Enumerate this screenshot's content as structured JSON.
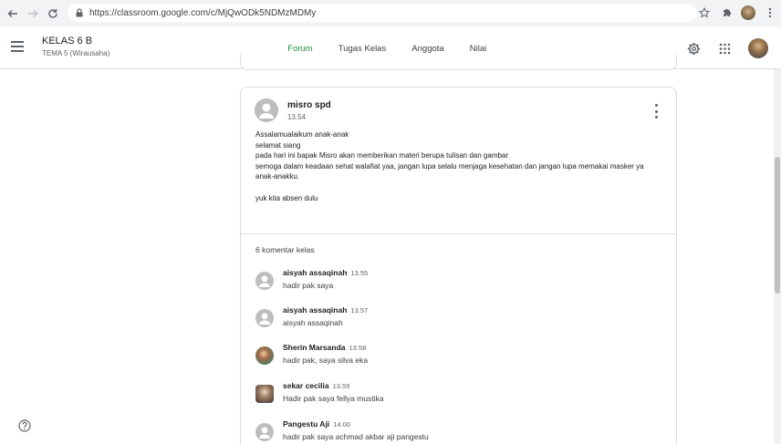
{
  "browser": {
    "url": "https://classroom.google.com/c/MjQwODk5NDMzMDMy"
  },
  "header": {
    "class_title": "KELAS 6 B",
    "class_subtitle": "TEMA 5 (Wirausaha)",
    "tabs": [
      {
        "label": "Forum",
        "active": true
      },
      {
        "label": "Tugas Kelas",
        "active": false
      },
      {
        "label": "Anggota",
        "active": false
      },
      {
        "label": "Nilai",
        "active": false
      }
    ]
  },
  "post": {
    "author": "misro spd",
    "time": "13.54",
    "body": [
      "Assalamualaikum anak-anak",
      "selamat siang",
      "pada hari ini bapak Misro akan memberikan materi berupa tulisan dan gambar",
      "semoga dalam keadaan sehat walafiat yaa, jangan lupa selalu menjaga kesehatan dan jangan lupa memakai masker ya",
      "anak-anakku.",
      "",
      "yuk kita absen dulu"
    ],
    "comments_count": "6 komentar kelas",
    "comments": [
      {
        "name": "aisyah assaqinah",
        "time": "13.55",
        "text": "hadir pak saya",
        "avatar": "default"
      },
      {
        "name": "aisyah assaqinah",
        "time": "13.57",
        "text": "aisyah assaqinah",
        "avatar": "default"
      },
      {
        "name": "Sherin Marsanda",
        "time": "13.58",
        "text": "hadir pak, saya silva eka",
        "avatar": "photo-1"
      },
      {
        "name": "sekar cecilia",
        "time": "13.59",
        "text": "Hadir pak saya fellya mustika",
        "avatar": "photo-2"
      },
      {
        "name": "Pangestu Aji",
        "time": "14.00",
        "text": "hadir pak saya achmad akbar aji pangestu",
        "avatar": "default"
      }
    ]
  },
  "colors": {
    "accent": "#1e8e3e",
    "text": "#202124",
    "secondary_text": "#5f6368",
    "border": "#dadce0"
  }
}
